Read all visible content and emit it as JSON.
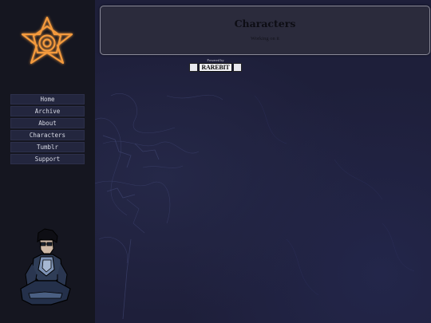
{
  "sidebar": {
    "nav": [
      {
        "label": "Home"
      },
      {
        "label": "Archive"
      },
      {
        "label": "About"
      },
      {
        "label": "Characters"
      },
      {
        "label": "Tumblr"
      },
      {
        "label": "Support"
      }
    ]
  },
  "main": {
    "panel": {
      "title": "Characters",
      "subtitle": "Working on it"
    },
    "badge": {
      "powered_by": "Powered by",
      "name": "RAREBIT"
    }
  },
  "colors": {
    "sidebar_bg": "#151620",
    "main_bg": "#1e1f3a",
    "logo_accent": "#f49a3c",
    "panel_bg": "#2b2b3c"
  }
}
